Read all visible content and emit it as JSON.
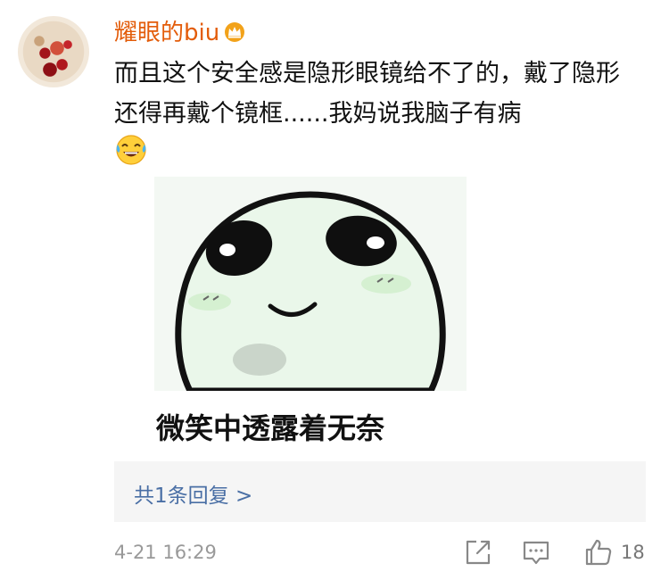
{
  "comment": {
    "username": "耀眼的biu",
    "text": "而且这个安全感是隐形眼镜给不了的，戴了隐形还得再戴个镜框......我妈说我脑子有病",
    "inline_emoji": "laugh-cry-icon"
  },
  "meme": {
    "caption": "微笑中透露着无奈"
  },
  "replies": {
    "link_label": "共1条回复 >"
  },
  "footer": {
    "timestamp": "4-21 16:29",
    "like_count": "18"
  },
  "colors": {
    "username": "#e35c0a",
    "reply_link": "#4a6fa5",
    "reply_bg": "#f5f5f5",
    "meta": "#999999"
  }
}
